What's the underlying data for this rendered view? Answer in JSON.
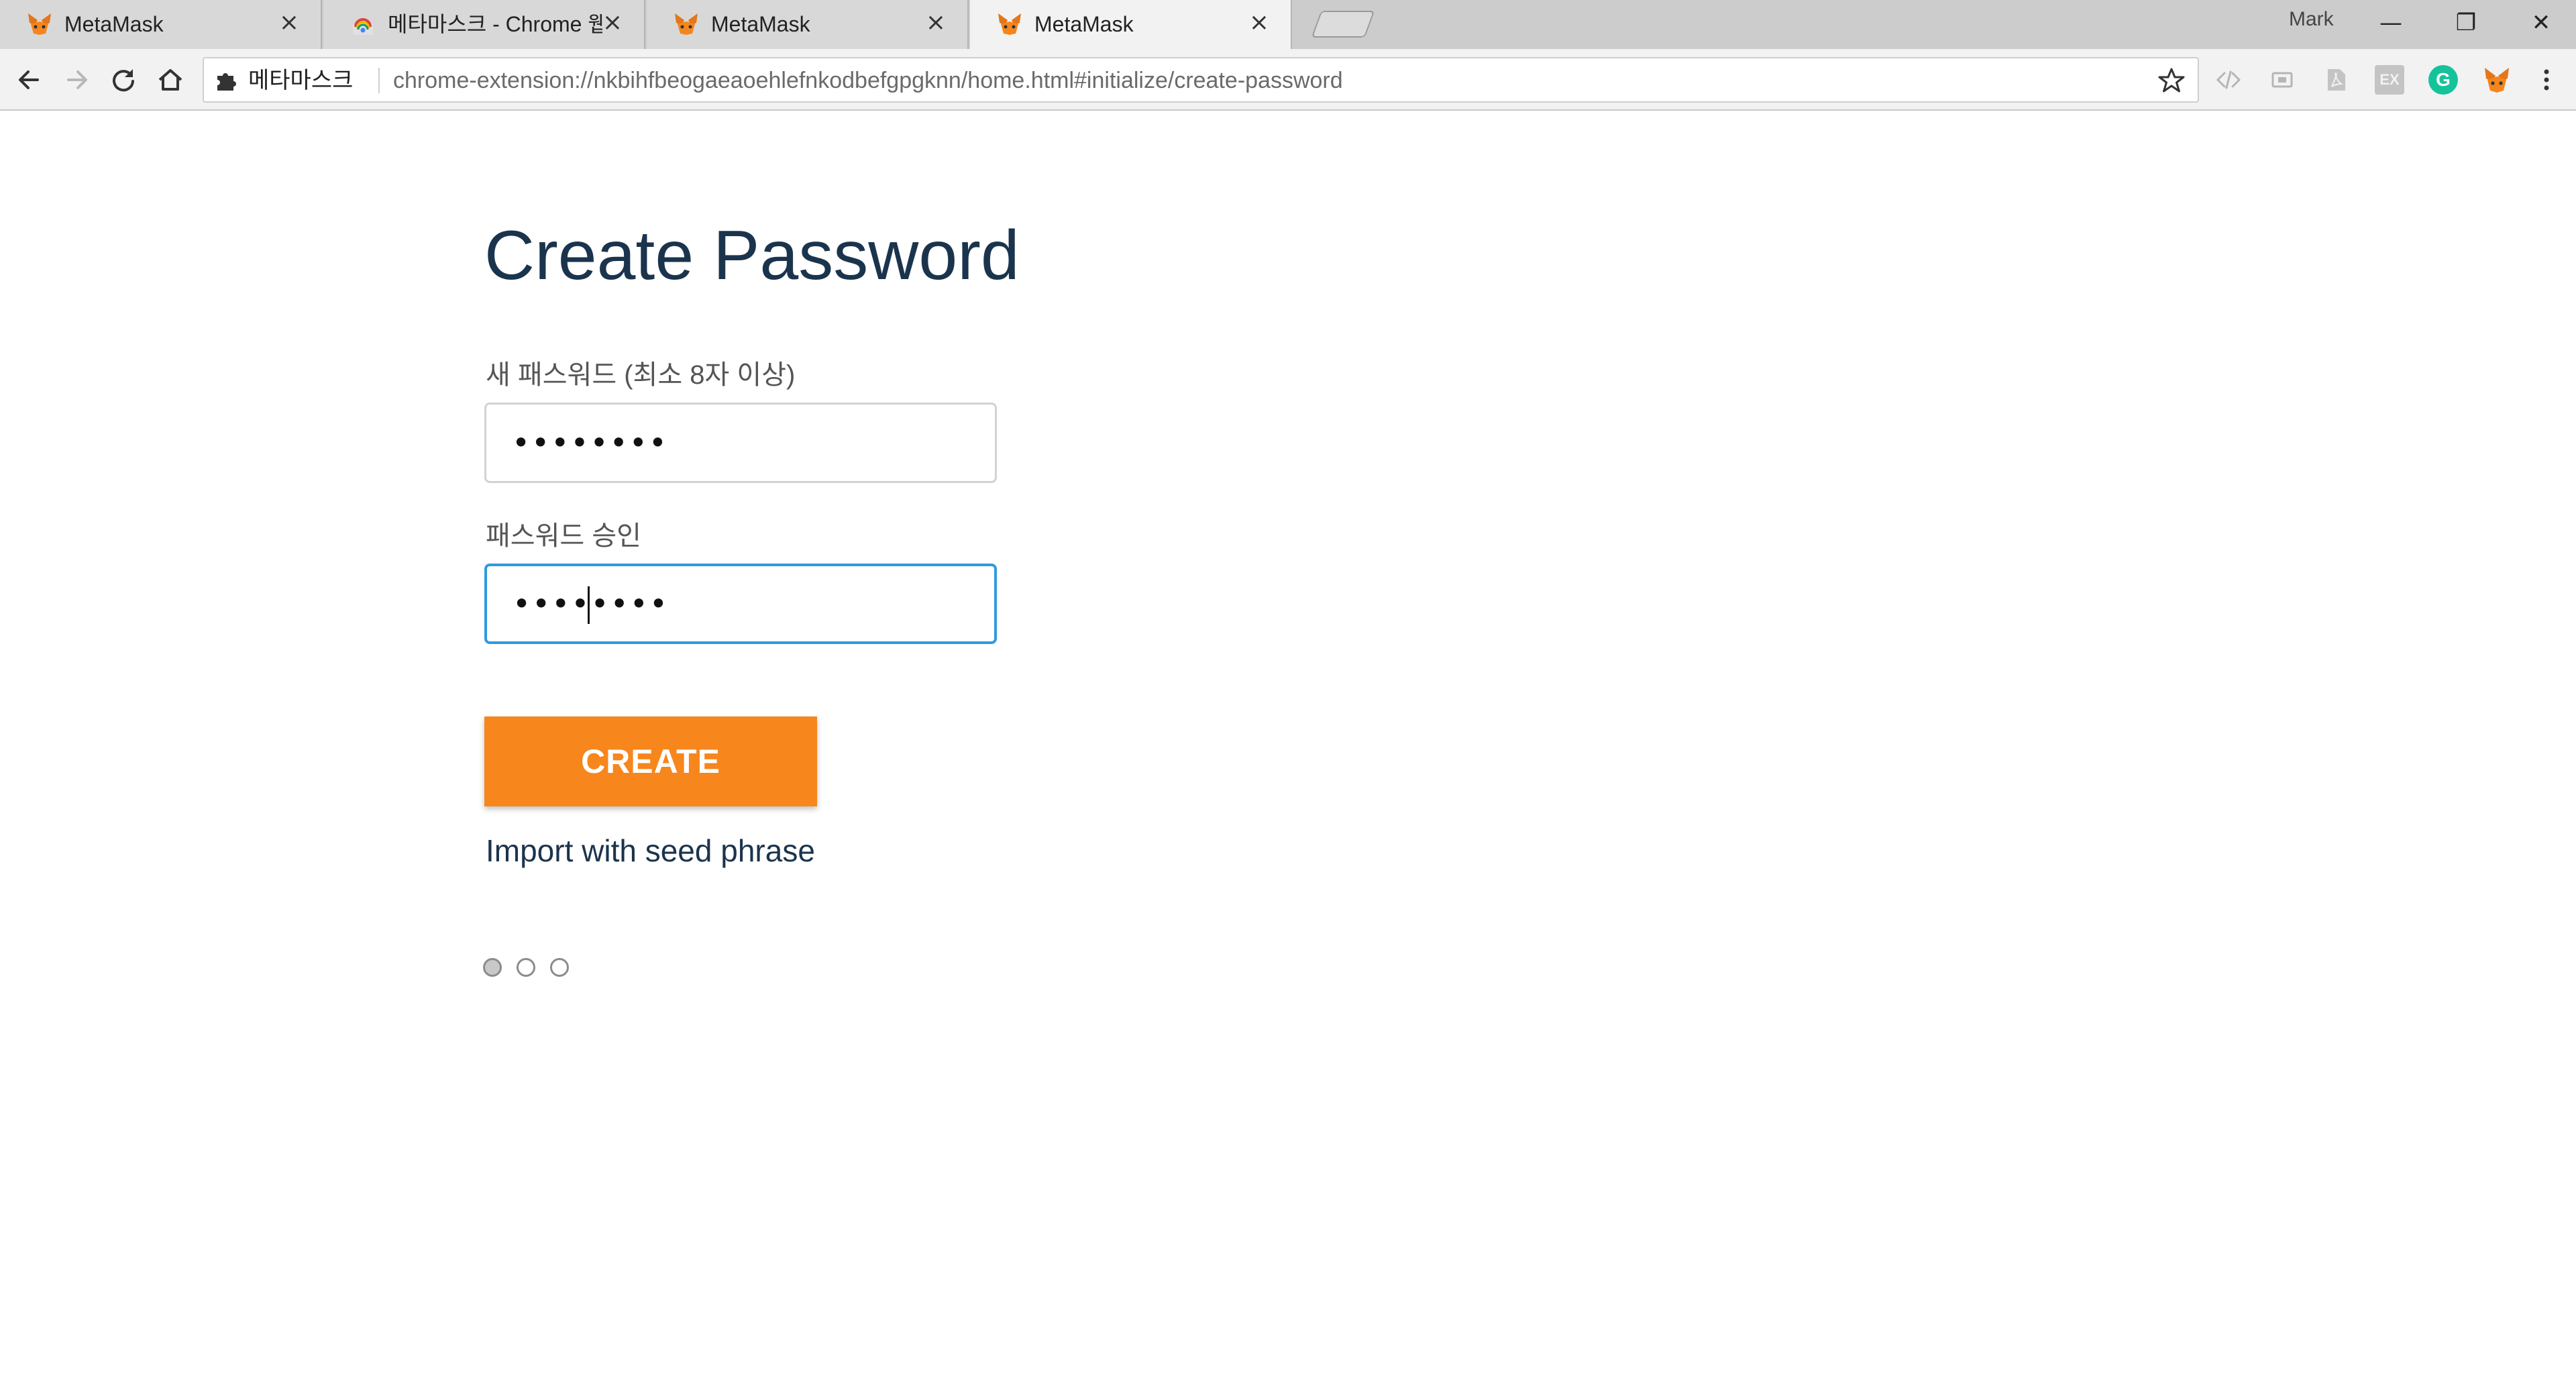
{
  "browser": {
    "tabs": [
      {
        "title": "MetaMask",
        "icon": "metamask-fox-icon",
        "active": false
      },
      {
        "title": "메타마스크 - Chrome 웹",
        "icon": "chrome-web-store-icon",
        "active": false
      },
      {
        "title": "MetaMask",
        "icon": "metamask-fox-icon",
        "active": false
      },
      {
        "title": "MetaMask",
        "icon": "metamask-fox-icon",
        "active": true
      }
    ],
    "tab_close_glyph": "×",
    "profile_name": "Mark",
    "window_controls": {
      "minimize": "—",
      "restore": "❐",
      "close": "✕"
    },
    "address_bar": {
      "site_label": "메타마스크",
      "url": "chrome-extension://nkbihfbeogaeaoehlefnkodbefgpgknn/home.html#initialize/create-password"
    },
    "extensions": [
      "code-icon",
      "cast-icon",
      "pdf-icon",
      "ex-icon",
      "grammarly-icon",
      "metamask-fox-icon",
      "menu-icon"
    ],
    "extension_texts": {
      "ex": "EX",
      "grammarly": "G"
    }
  },
  "page": {
    "title": "Create Password",
    "new_password": {
      "label": "새 패스워드 (최소 8자 이상)",
      "value": "••••••••"
    },
    "confirm_password": {
      "label": "패스워드 승인",
      "value": "••••••••"
    },
    "create_button": "CREATE",
    "import_link": "Import with seed phrase",
    "steps": {
      "total": 3,
      "current": 1
    }
  },
  "colors": {
    "accent_orange": "#f7861c",
    "heading_navy": "#1b344d",
    "focus_blue": "#2f9ae0"
  }
}
